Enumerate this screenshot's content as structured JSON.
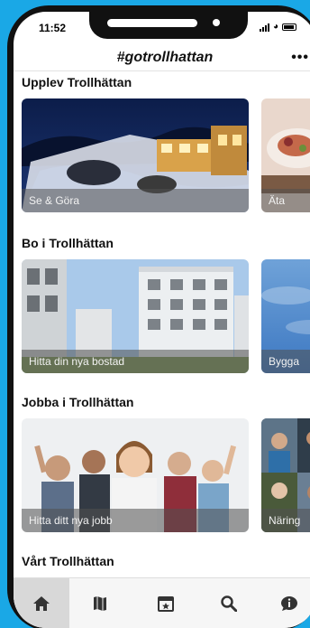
{
  "status_bar": {
    "time": "11:52"
  },
  "header": {
    "title": "#gotrollhattan",
    "more_icon": "more-horizontal-icon"
  },
  "sections": [
    {
      "title": "Upplev Trollhättan",
      "cards": [
        {
          "label": "Se & Göra",
          "image": "waterfall-night-photo"
        },
        {
          "label": "Äta",
          "image": "food-dish-photo"
        }
      ]
    },
    {
      "title": "Bo i Trollhättan",
      "cards": [
        {
          "label": "Hitta din nya bostad",
          "image": "apartment-buildings-photo"
        },
        {
          "label": "Bygga",
          "image": "blue-sky-photo"
        }
      ]
    },
    {
      "title": "Jobba i Trollhättan",
      "cards": [
        {
          "label": "Hitta ditt nya jobb",
          "image": "cheering-people-photo"
        },
        {
          "label": "Näring",
          "image": "office-workers-photo"
        }
      ]
    },
    {
      "title": "Vårt Trollhättan",
      "cards": []
    }
  ],
  "tabbar": {
    "items": [
      {
        "icon": "home-icon",
        "active": true
      },
      {
        "icon": "map-icon",
        "active": false
      },
      {
        "icon": "calendar-star-icon",
        "active": false
      },
      {
        "icon": "search-icon",
        "active": false
      },
      {
        "icon": "info-chat-icon",
        "active": false
      }
    ]
  },
  "colors": {
    "background": "#1aa8e6",
    "label_overlay": "#505050"
  }
}
